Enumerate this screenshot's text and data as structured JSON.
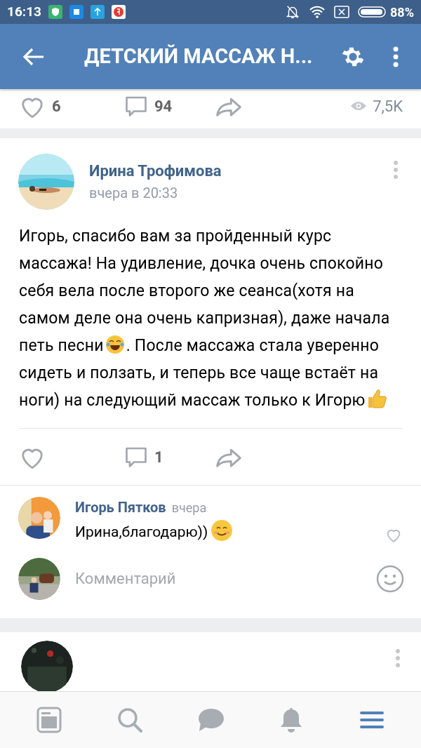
{
  "status_bar": {
    "time": "16:13",
    "battery": "88%"
  },
  "header": {
    "title": "ДЕТСКИЙ МАССАЖ Н..."
  },
  "previous_post": {
    "likes": "6",
    "comments": "94",
    "views": "7,5K"
  },
  "post": {
    "author": "Ирина Трофимова",
    "time": "вчера в 20:33",
    "body": [
      {
        "kind": "text",
        "text": "Игорь, спасибо вам за пройденный курс массажа! На удивление, дочка очень спокойно себя вела после второго же сеанса(хотя на самом деле она очень капризная), даже начала петь песни"
      },
      {
        "kind": "laughing"
      },
      {
        "kind": "text",
        "text": ". После массажа стала уверенно сидеть и ползать, и теперь все чаще встаёт на ноги) на следующий массаж только к Игорю"
      },
      {
        "kind": "thumbs"
      }
    ],
    "comments": "1"
  },
  "comments": [
    {
      "author": "Игорь Пятков",
      "time": "вчера",
      "text": [
        {
          "kind": "text",
          "text": "Ирина,благодарю))"
        },
        {
          "kind": "smile"
        }
      ]
    }
  ],
  "comment_field": {
    "placeholder": "Комментарий"
  },
  "bottom_nav": [
    {
      "kind": "news",
      "selected": false
    },
    {
      "kind": "search",
      "selected": false
    },
    {
      "kind": "messages",
      "selected": false
    },
    {
      "kind": "notifications",
      "selected": false
    },
    {
      "kind": "menu",
      "selected": true
    }
  ]
}
